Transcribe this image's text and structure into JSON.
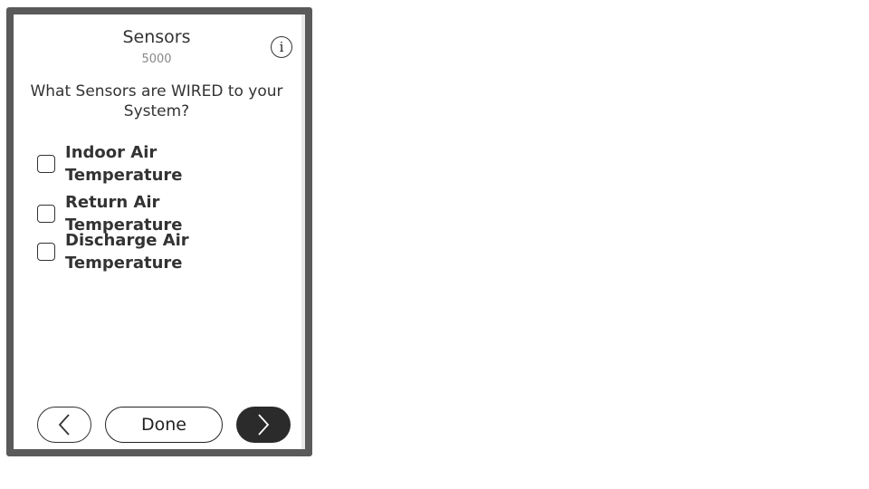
{
  "header": {
    "title": "Sensors",
    "subtitle": "5000",
    "info_icon": "info-icon",
    "info_glyph": "i"
  },
  "question": "What Sensors are WIRED to your System?",
  "options": [
    {
      "label": "Indoor Air Temperature",
      "checked": false
    },
    {
      "label": "Return Air Temperature",
      "checked": false
    },
    {
      "label": "Discharge Air Temperature",
      "checked": false
    }
  ],
  "footer": {
    "back_icon": "chevron-left-icon",
    "done_label": "Done",
    "next_icon": "chevron-right-icon"
  },
  "colors": {
    "frame": "#5a5a5a",
    "text": "#333333",
    "subtitle": "#888888",
    "next_button": "#2b2b2b"
  }
}
